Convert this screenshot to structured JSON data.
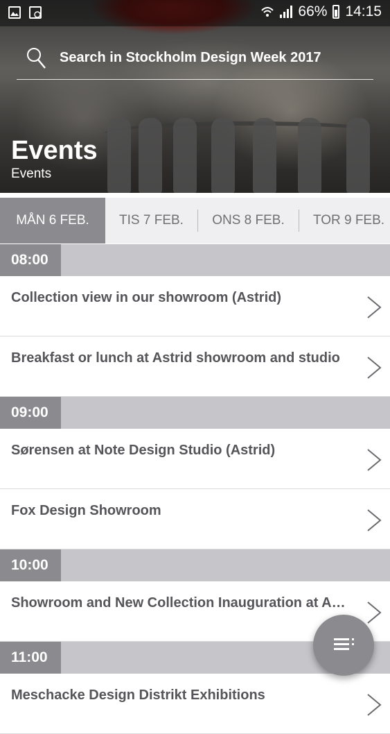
{
  "status_bar": {
    "battery_percent": "66%",
    "time": "14:15",
    "left_icons": [
      "image-icon",
      "clock-icon"
    ],
    "right_icons": [
      "wifi-icon",
      "signal-icon",
      "battery-icon"
    ]
  },
  "header": {
    "search_placeholder": "Search in Stockholm Design Week 2017",
    "title": "Events",
    "subtitle": "Events"
  },
  "tabs": [
    {
      "label": "MÅN 6 FEB.",
      "active": true
    },
    {
      "label": "TIS 7 FEB.",
      "active": false
    },
    {
      "label": "ONS 8 FEB.",
      "active": false
    },
    {
      "label": "TOR 9 FEB.",
      "active": false
    }
  ],
  "schedule": [
    {
      "time": "08:00",
      "events": [
        "Collection view in our showroom (Astrid)",
        "Breakfast or lunch at Astrid showroom and studio"
      ]
    },
    {
      "time": "09:00",
      "events": [
        "Sørensen at Note Design Studio (Astrid)",
        "Fox Design Showroom"
      ]
    },
    {
      "time": "10:00",
      "events": [
        "Showroom and New Collection Inauguration at Astrid"
      ]
    },
    {
      "time": "11:00",
      "events": [
        "Meschacke Design Distrikt Exhibitions"
      ]
    }
  ],
  "fab": {
    "icon": "list-menu-icon"
  },
  "colors": {
    "accent_gray": "#8b8a8e",
    "header_band": "#c6c5c9",
    "text": "#555459"
  }
}
